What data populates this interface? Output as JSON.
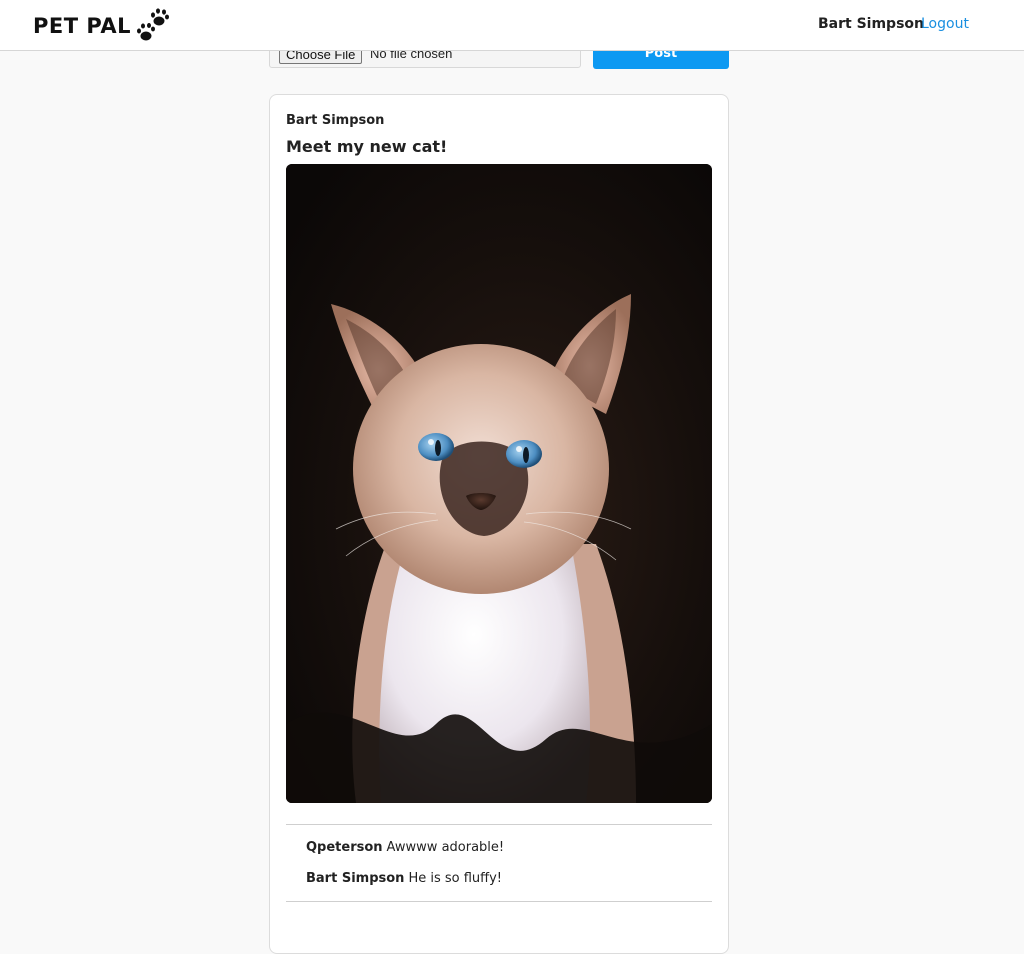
{
  "app": {
    "logo_text": "PET PAL",
    "accent_color": "#0d99f2"
  },
  "nav": {
    "user_name": "Bart Simpson",
    "logout_label": "Logout"
  },
  "composer": {
    "choose_file_label": "Choose File",
    "file_status": "No file chosen",
    "post_label": "Post"
  },
  "post": {
    "author": "Bart Simpson",
    "title": "Meet my new cat!",
    "image_subject": "kitten-photo",
    "comments": [
      {
        "user": "Qpeterson",
        "text": "Awwww adorable!"
      },
      {
        "user": "Bart Simpson",
        "text": "He is so fluffy!"
      }
    ]
  }
}
